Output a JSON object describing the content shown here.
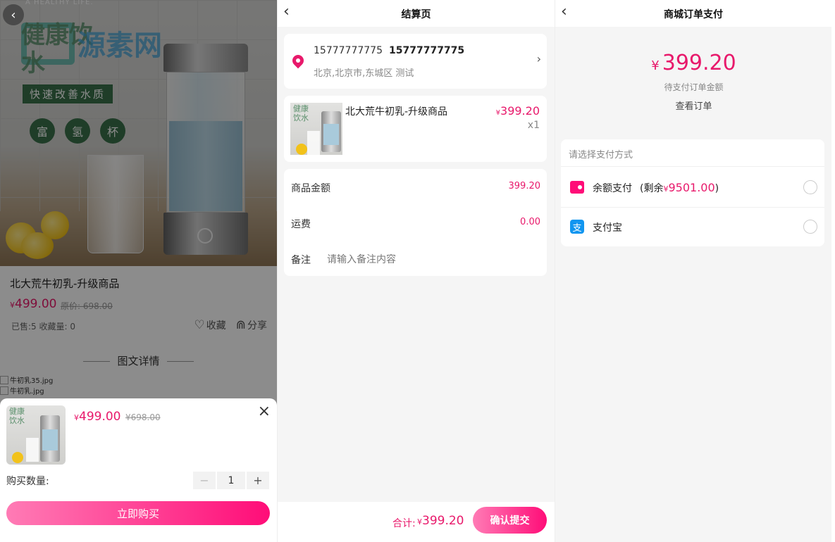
{
  "product": {
    "hero": {
      "tagline": "A HEALTHY LIFE.",
      "title": "健康饮水",
      "banner": "快速改善水质",
      "badges": [
        "富",
        "氢",
        "杯"
      ],
      "watermark": "源素网"
    },
    "title": "北大荒牛初乳-升级商品",
    "currency": "¥",
    "price": "499.00",
    "original_price": "原价: 698.00",
    "sold_line": "已售:5 收藏量: 0",
    "favorite_label": "收藏",
    "share_label": "分享",
    "detail_heading": "图文详情",
    "detail_images": [
      "牛初乳35.jpg",
      "牛初乳.jpg"
    ],
    "sheet": {
      "price": "499.00",
      "original_price": "¥698.00",
      "thumb_title": "健康饮水",
      "quantity_label": "购买数量:",
      "quantity": "1",
      "minus": "−",
      "plus": "+",
      "buy_label": "立即购买",
      "close": "×"
    }
  },
  "checkout": {
    "title": "结算页",
    "address": {
      "name": "15777777775",
      "phone": "15777777775",
      "detail": "北京,北京市,东城区 测试"
    },
    "item": {
      "name": "北大荒牛初乳-升级商品",
      "price": "399.20",
      "quantity": "x1"
    },
    "rows": {
      "goods_amount_label": "商品金额",
      "goods_amount": "399.20",
      "shipping_label": "运费",
      "shipping": "0.00",
      "note_label": "备注",
      "note_placeholder": "请输入备注内容"
    },
    "footer": {
      "total_label": "合计:",
      "total": "399.20",
      "submit_label": "确认提交"
    }
  },
  "payment": {
    "title": "商城订单支付",
    "amount": "399.20",
    "amount_caption": "待支付订单金额",
    "view_order": "查看订单",
    "choose_label": "请选择支付方式",
    "methods": [
      {
        "label": "余额支付",
        "balance_prefix": "(剩余",
        "balance": "9501.00",
        "balance_suffix": ")",
        "icon": "wallet-icon"
      },
      {
        "label": "支付宝",
        "icon": "alipay-icon",
        "icon_glyph": "支"
      }
    ]
  },
  "colors": {
    "accent": "#e8196b",
    "button_gradient_start": "#ff7bb5",
    "button_gradient_end": "#ff0d78",
    "alipay_blue": "#1296f0"
  }
}
